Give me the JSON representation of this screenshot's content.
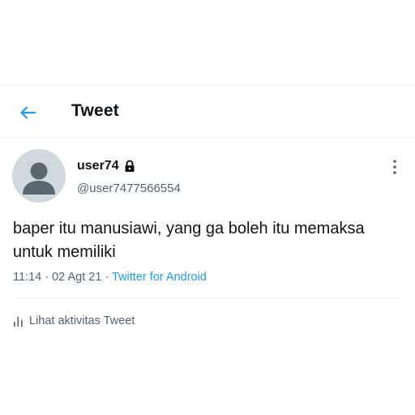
{
  "header": {
    "back_icon": "arrow-left-icon",
    "title": "Tweet"
  },
  "tweet": {
    "author": {
      "display_name": "user74",
      "handle": "@user7477566554",
      "protected_icon": "lock-icon",
      "avatar": "default-avatar"
    },
    "more_icon": "more-vertical-icon",
    "text": "baper itu manusiawi, yang ga boleh itu memaksa untuk memiliki",
    "time": "11:14",
    "separator": " · ",
    "date": "02 Agt 21",
    "source": "Twitter for Android",
    "activity": {
      "icon": "bar-chart-icon",
      "label": "Lihat aktivitas Tweet"
    }
  },
  "colors": {
    "accent": "#1d9bf0",
    "text_primary": "#0f1419",
    "text_secondary": "#536471",
    "divider": "#eff3f4",
    "avatar_bg": "#cfd9de",
    "avatar_figure": "#5b6770"
  }
}
